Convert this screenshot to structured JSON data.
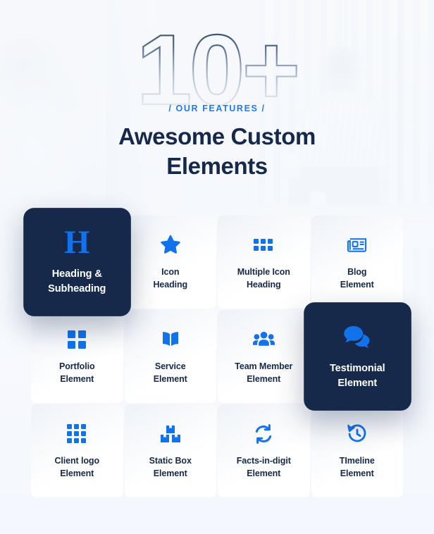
{
  "hero": {
    "big_number": "10+",
    "eyebrow": "/ OUR FEATURES /",
    "headline_line1": "Awesome Custom",
    "headline_line2": "Elements"
  },
  "colors": {
    "accent_blue": "#1272ec",
    "eyebrow_blue": "#1a7bf7",
    "navy": "#16294a",
    "page_bg": "#f4f7fd",
    "card_bg": "#ffffff"
  },
  "cards": [
    {
      "icon": "heading-h-icon",
      "line1": "Heading &",
      "line2": "Subheading",
      "active": true
    },
    {
      "icon": "star-icon",
      "line1": "Icon",
      "line2": "Heading",
      "active": false
    },
    {
      "icon": "multiple-dots-icon",
      "line1": "Multiple Icon",
      "line2": "Heading",
      "active": false
    },
    {
      "icon": "newspaper-icon",
      "line1": "Blog",
      "line2": "Element",
      "active": false
    },
    {
      "icon": "grid-four-icon",
      "line1": "Portfolio",
      "line2": "Element",
      "active": false
    },
    {
      "icon": "open-book-icon",
      "line1": "Service",
      "line2": "Element",
      "active": false
    },
    {
      "icon": "users-group-icon",
      "line1": "Team Member",
      "line2": "Element",
      "active": false
    },
    {
      "icon": "chat-bubbles-icon",
      "line1": "Testimonial",
      "line2": "Element",
      "active": true
    },
    {
      "icon": "grid-nine-icon",
      "line1": "Client logo",
      "line2": "Element",
      "active": false
    },
    {
      "icon": "boxes-icon",
      "line1": "Static Box",
      "line2": "Element",
      "active": false
    },
    {
      "icon": "refresh-cycle-icon",
      "line1": "Facts-in-digit",
      "line2": "Element",
      "active": false
    },
    {
      "icon": "clock-history-icon",
      "line1": "TImeline",
      "line2": "Element",
      "active": false
    }
  ]
}
